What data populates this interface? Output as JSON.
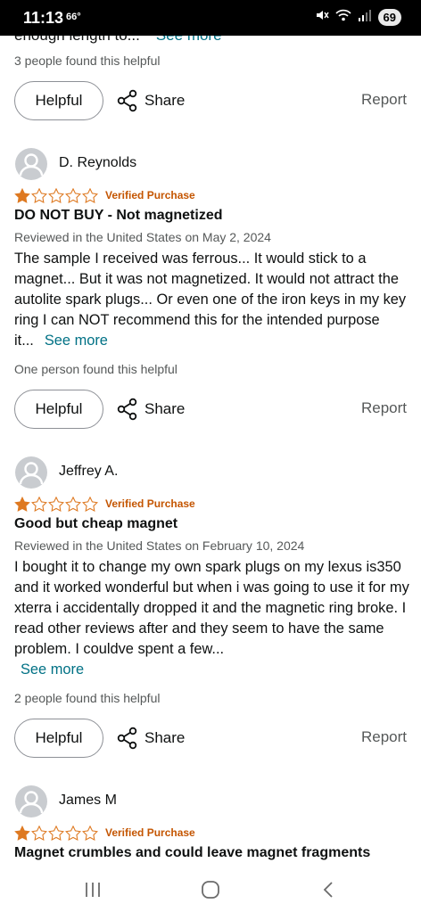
{
  "status_bar": {
    "time": "11:13",
    "temperature": "66°",
    "battery": "69",
    "icons": [
      "mute-icon",
      "wifi-icon",
      "signal-icon",
      "battery-icon"
    ]
  },
  "top_partial": {
    "text": "enough length to...",
    "see_more": "See more"
  },
  "first_helpful_count": "3 people found this helpful",
  "actions": {
    "helpful_label": "Helpful",
    "share_label": "Share",
    "report_label": "Report"
  },
  "colors": {
    "link": "#007185",
    "verified": "#c45500",
    "star": "#de7921",
    "muted": "#565959"
  },
  "reviews": [
    {
      "reviewer": "D. Reynolds",
      "rating": 1,
      "verified": "Verified Purchase",
      "title": "DO NOT BUY - Not magnetized",
      "meta": "Reviewed in the United States on May 2, 2024",
      "body": "The sample I received was ferrous... It would stick to a magnet... But it was not magnetized. It would not attract the autolite spark plugs... Or even one of the iron keys in my key ring I can NOT recommend this for the intended purpose it...",
      "see_more": "See more",
      "helpful_count": "One person found this helpful"
    },
    {
      "reviewer": "Jeffrey A.",
      "rating": 1,
      "verified": "Verified Purchase",
      "title": "Good but cheap magnet",
      "meta": "Reviewed in the United States on February 10, 2024",
      "body": "I bought it to change my own spark plugs on my lexus is350 and it worked wonderful but when i was going to use it for my xterra i accidentally dropped it and the magnetic ring broke. I read other reviews after and they seem to have the same problem. I couldve spent a few...",
      "see_more": "See more",
      "helpful_count": "2 people found this helpful"
    },
    {
      "reviewer": "James M",
      "rating": 1,
      "verified": "Verified Purchase",
      "title": "Magnet crumbles and could leave magnet fragments"
    }
  ]
}
